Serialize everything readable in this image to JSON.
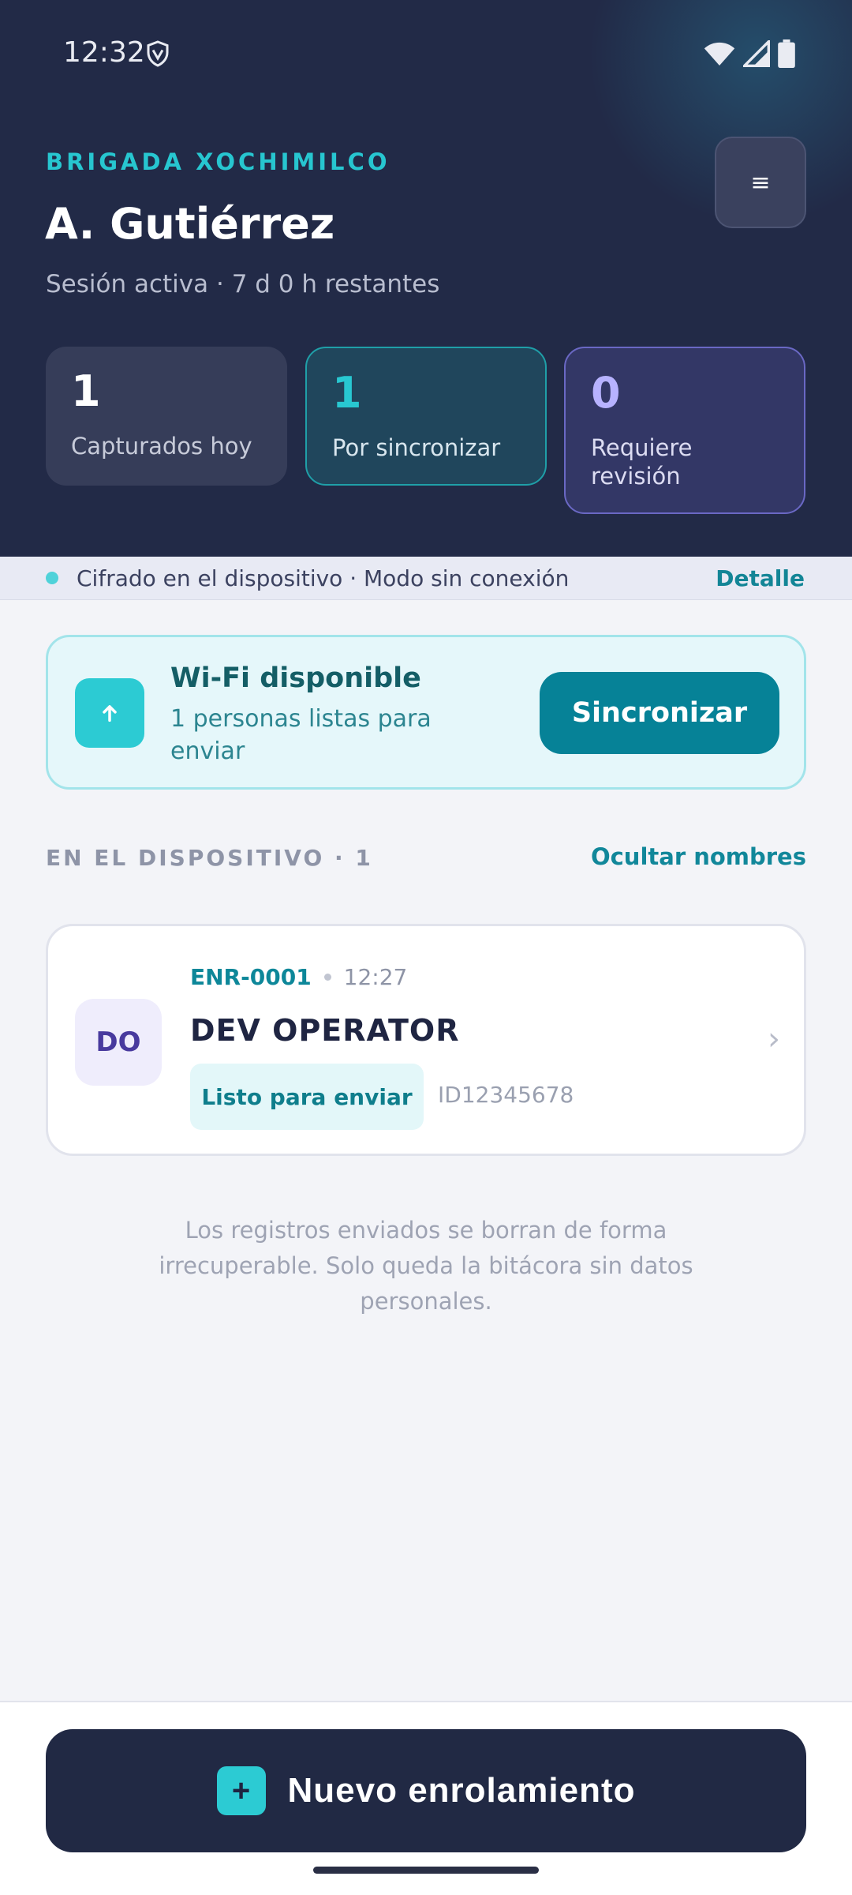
{
  "status_bar": {
    "time": "12:32"
  },
  "header": {
    "brigade": "BRIGADA XOCHIMILCO",
    "user_name": "A. Gutiérrez",
    "session": "Sesión activa · 7 d 0 h restantes",
    "menu_icon": "≡"
  },
  "stats": [
    {
      "value": "1",
      "label": "Capturados hoy"
    },
    {
      "value": "1",
      "label": "Por sincronizar"
    },
    {
      "value": "0",
      "label": "Requiere revisión"
    }
  ],
  "info_strip": {
    "text": "Cifrado en el dispositivo · Modo sin conexión",
    "detail_label": "Detalle"
  },
  "sync_card": {
    "title": "Wi-Fi disponible",
    "subtitle": "1 personas listas para enviar",
    "button_label": "Sincronizar"
  },
  "section": {
    "title": "EN EL DISPOSITIVO · 1",
    "hide_names_label": "Ocultar nombres"
  },
  "records": [
    {
      "initials": "DO",
      "id": "ENR-0001",
      "time": "12:27",
      "name": "DEV OPERATOR",
      "status": "Listo para enviar",
      "document": "ID12345678"
    }
  ],
  "note": "Los registros enviados se borran de forma irrecuperable. Solo queda la bitácora sin datos personales.",
  "bottom": {
    "plus": "+",
    "new_label": "Nuevo enrolamiento"
  },
  "colors": {
    "header_bg": "#222a47",
    "accent_teal": "#2ccbd3",
    "primary_button": "#068297",
    "review_purple": "#6a68c4"
  }
}
